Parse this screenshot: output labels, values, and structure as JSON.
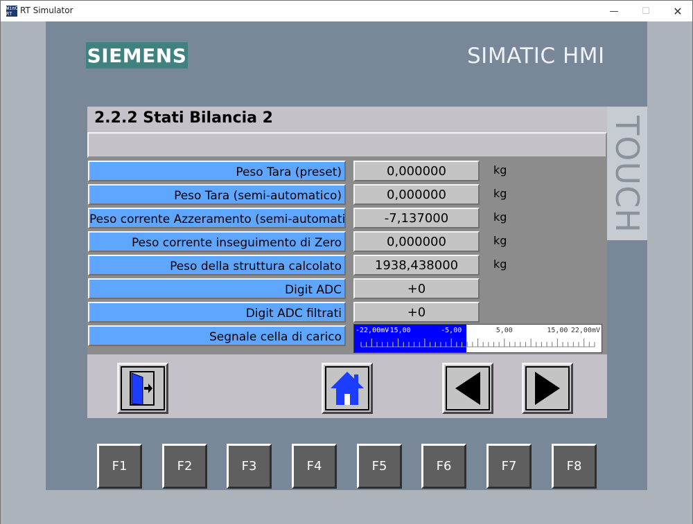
{
  "window": {
    "title": "RT Simulator",
    "icon_text": "WinCC RT",
    "minimize_glyph": "—",
    "maximize_glyph": "☐",
    "close_glyph": "✕"
  },
  "device": {
    "brand": "SIEMENS",
    "model": "SIMATIC HMI",
    "touch_label": "TOUCH"
  },
  "screen": {
    "title": "2.2.2 Stati Bilancia 2",
    "message": "",
    "rows": [
      {
        "label": "Peso Tara (preset)",
        "value": "0,000000",
        "unit": "kg"
      },
      {
        "label": "Peso Tara (semi-automatico)",
        "value": "0,000000",
        "unit": "kg"
      },
      {
        "label": "Peso corrente Azzeramento (semi-automatico)",
        "value": "-7,137000",
        "unit": "kg"
      },
      {
        "label": "Peso corrente inseguimento di Zero",
        "value": "0,000000",
        "unit": "kg"
      },
      {
        "label": "Peso della struttura calcolato",
        "value": "1938,438000",
        "unit": "kg"
      },
      {
        "label": "Digit ADC",
        "value": "+0",
        "unit": ""
      },
      {
        "label": "Digit ADC filtrati",
        "value": "+0",
        "unit": ""
      }
    ],
    "signal": {
      "label": "Segnale cella di carico",
      "scale_min": -22,
      "scale_max": 22,
      "value": -2,
      "tick_labels": [
        "-22,00mV",
        "-15,00",
        "-5,00",
        "5,00",
        "15,00",
        "22,00mV"
      ],
      "fill_color": "#0000ff"
    },
    "nav_buttons": [
      {
        "name": "exit",
        "icon": "exit-door-icon"
      },
      {
        "name": "home",
        "icon": "home-icon"
      },
      {
        "name": "previous",
        "icon": "arrow-left-icon"
      },
      {
        "name": "next",
        "icon": "arrow-right-icon"
      }
    ]
  },
  "function_keys": [
    "F1",
    "F2",
    "F3",
    "F4",
    "F5",
    "F6",
    "F7",
    "F8"
  ],
  "colors": {
    "label_bg": "#5ea6ff",
    "brand_bg": "#3f827f",
    "panel_bg": "#788898",
    "home_icon": "#1c3cff"
  }
}
